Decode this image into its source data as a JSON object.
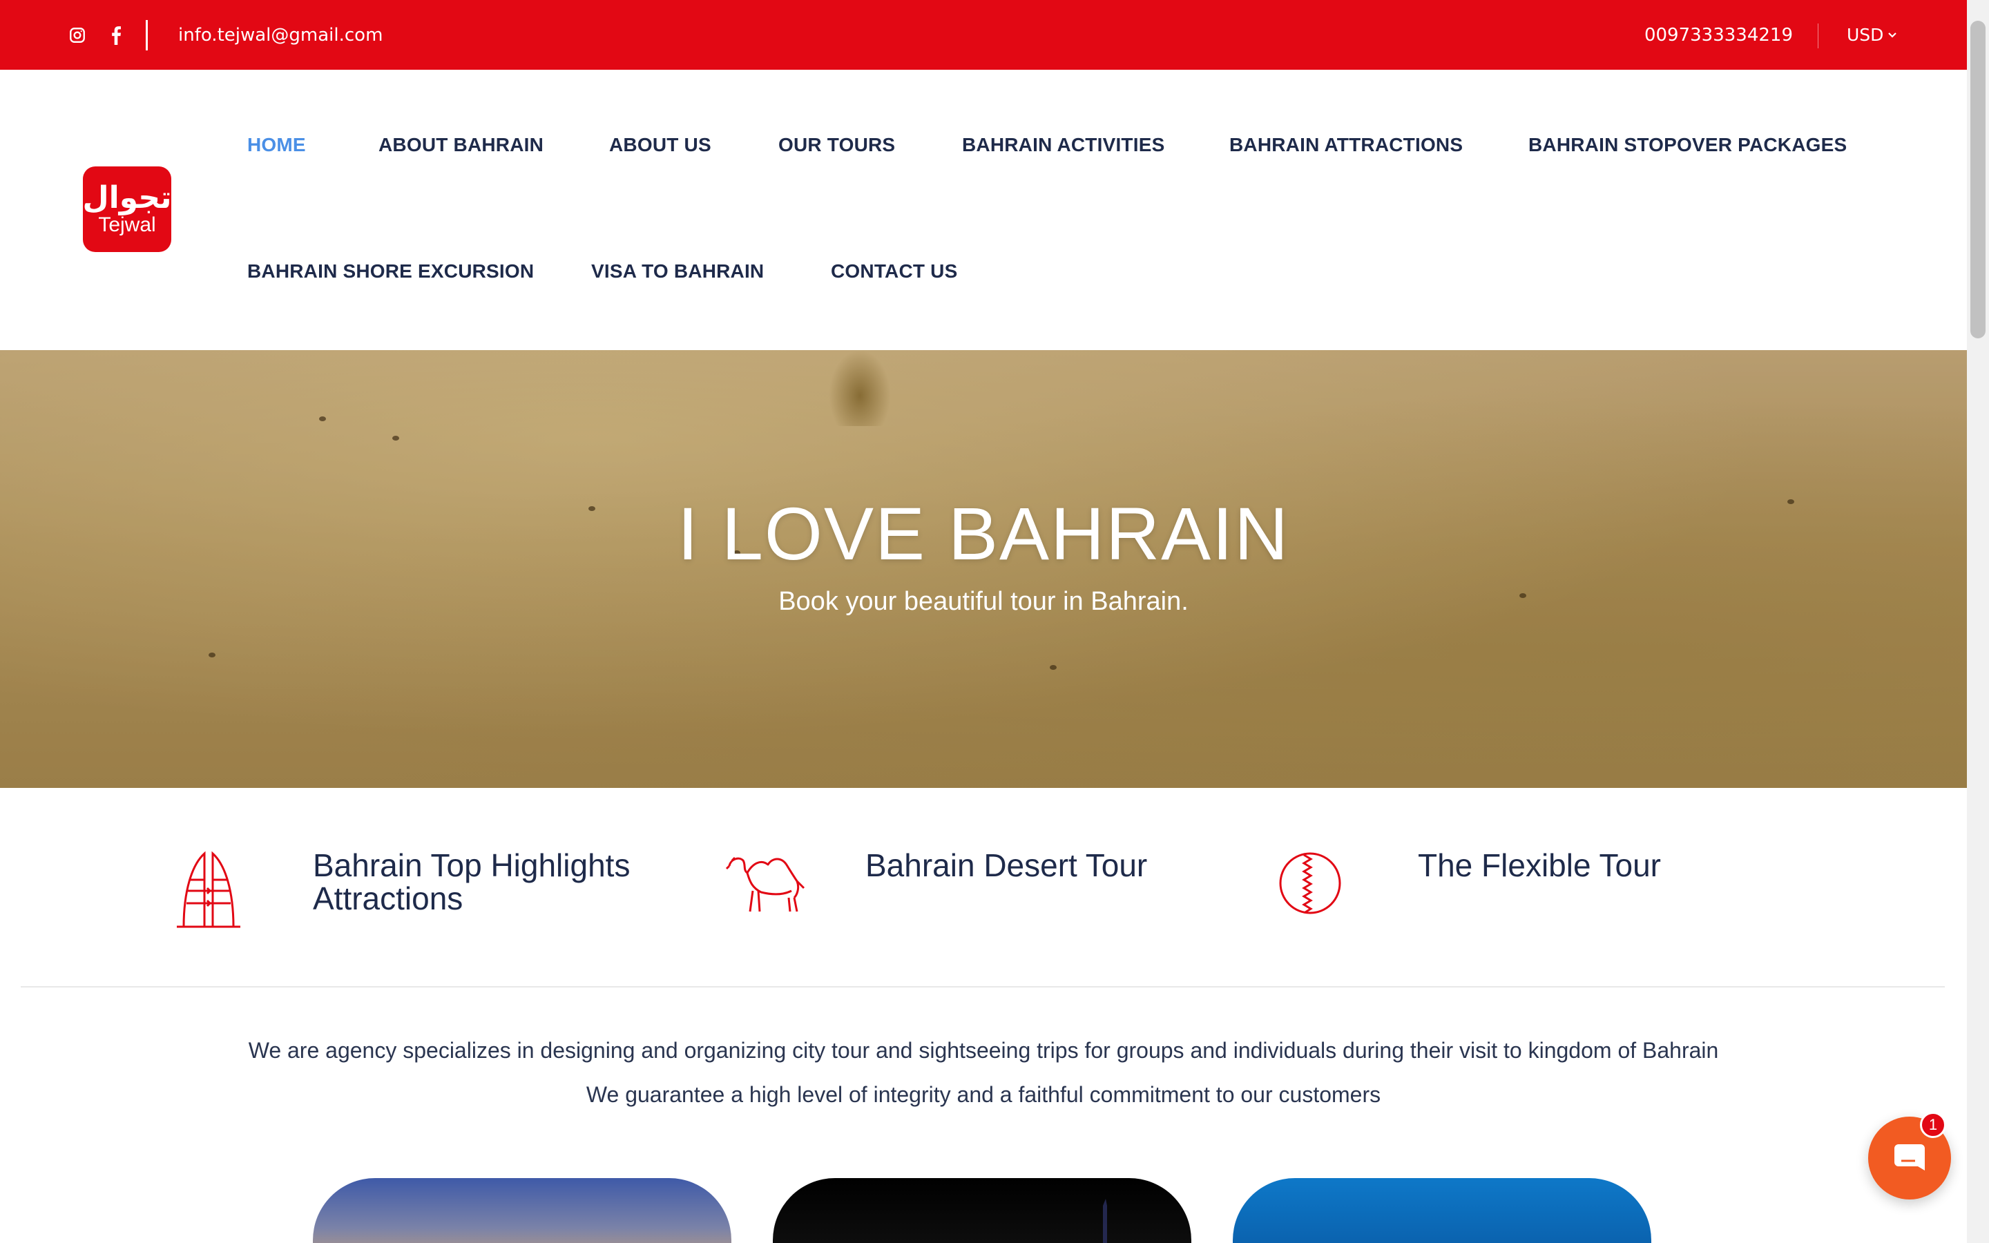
{
  "colors": {
    "brand_red": "#e20814",
    "nav_active": "#4a8fe6",
    "text_dark": "#1e2a4a",
    "chat_orange": "#f25b22"
  },
  "topbar": {
    "icons": [
      "instagram-icon",
      "facebook-icon"
    ],
    "email": "info.tejwal@gmail.com",
    "phone": "0097333334219",
    "currency": "USD"
  },
  "logo": {
    "arabic": "تجوال",
    "latin": "Tejwal"
  },
  "nav": {
    "items": [
      {
        "label": "HOME",
        "active": true
      },
      {
        "label": "ABOUT BAHRAIN"
      },
      {
        "label": "ABOUT US"
      },
      {
        "label": "OUR TOURS"
      },
      {
        "label": "BAHRAIN ACTIVITIES"
      },
      {
        "label": "BAHRAIN ATTRACTIONS"
      },
      {
        "label": "BAHRAIN STOPOVER PACKAGES"
      },
      {
        "label": "BAHRAIN SHORE EXCURSION"
      },
      {
        "label": "VISA TO BAHRAIN"
      },
      {
        "label": "CONTACT US"
      }
    ]
  },
  "hero": {
    "title": "I LOVE BAHRAIN",
    "subtitle": "Book your beautiful tour in Bahrain."
  },
  "features": [
    {
      "icon": "bahrain-tower-icon",
      "title": "Bahrain Top Highlights Attractions"
    },
    {
      "icon": "camel-icon",
      "title": "Bahrain Desert Tour"
    },
    {
      "icon": "bahrain-flag-circle-icon",
      "title": "The Flexible Tour"
    }
  ],
  "intro": {
    "line1": "We are agency specializes in designing and organizing city tour and sightseeing trips for groups and individuals during their visit to kingdom of Bahrain",
    "line2": "We guarantee a high level of integrity and a faithful commitment to our customers"
  },
  "chat": {
    "badge": "1",
    "icon": "chat-icon"
  }
}
